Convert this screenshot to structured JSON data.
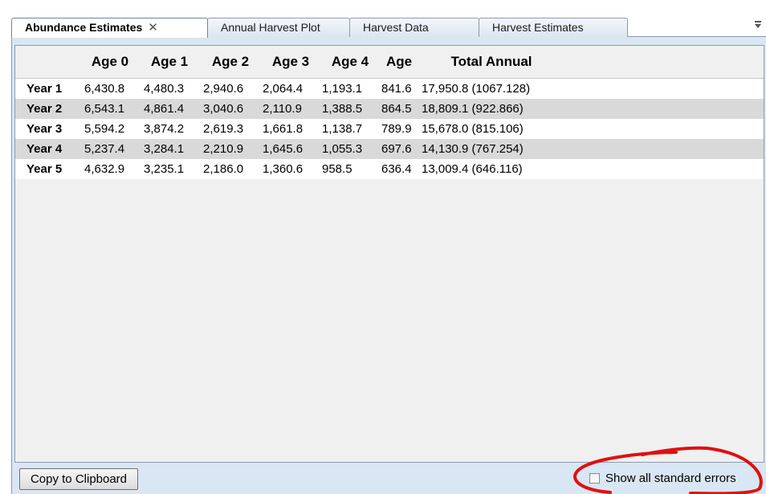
{
  "tabs": [
    {
      "label": "Abundance Estimates",
      "active": true,
      "close": "✕"
    },
    {
      "label": "Annual Harvest Plot"
    },
    {
      "label": "Harvest Data"
    },
    {
      "label": "Harvest Estimates"
    }
  ],
  "table": {
    "columns": [
      "",
      "Age 0",
      "Age 1",
      "Age 2",
      "Age 3",
      "Age 4",
      "Age",
      "Total Annual"
    ],
    "rows": [
      {
        "label": "Year 1",
        "cells": [
          "6,430.8",
          "4,480.3",
          "2,940.6",
          "2,064.4",
          "1,193.1",
          "841.6",
          "17,950.8 (1067.128)"
        ]
      },
      {
        "label": "Year 2",
        "cells": [
          "6,543.1",
          "4,861.4",
          "3,040.6",
          "2,110.9",
          "1,388.5",
          "864.5",
          "18,809.1 (922.866)"
        ]
      },
      {
        "label": "Year 3",
        "cells": [
          "5,594.2",
          "3,874.2",
          "2,619.3",
          "1,661.8",
          "1,138.7",
          "789.9",
          "15,678.0 (815.106)"
        ]
      },
      {
        "label": "Year 4",
        "cells": [
          "5,237.4",
          "3,284.1",
          "2,210.9",
          "1,645.6",
          "1,055.3",
          "697.6",
          "14,130.9 (767.254)"
        ]
      },
      {
        "label": "Year 5",
        "cells": [
          "4,632.9",
          "3,235.1",
          "2,186.0",
          "1,360.6",
          "958.5",
          "636.4",
          "13,009.4 (646.116)"
        ]
      }
    ]
  },
  "footer": {
    "copy_label": "Copy to Clipboard",
    "checkbox_label": "Show all standard errors",
    "checkbox_checked": false
  },
  "colors": {
    "panel": "#d9e6f3",
    "alt_row": "#d9d9d9",
    "annotation": "#e01010"
  },
  "icons": {
    "tab_overflow": "overflow-menu-icon",
    "tab_close": "close-icon"
  }
}
